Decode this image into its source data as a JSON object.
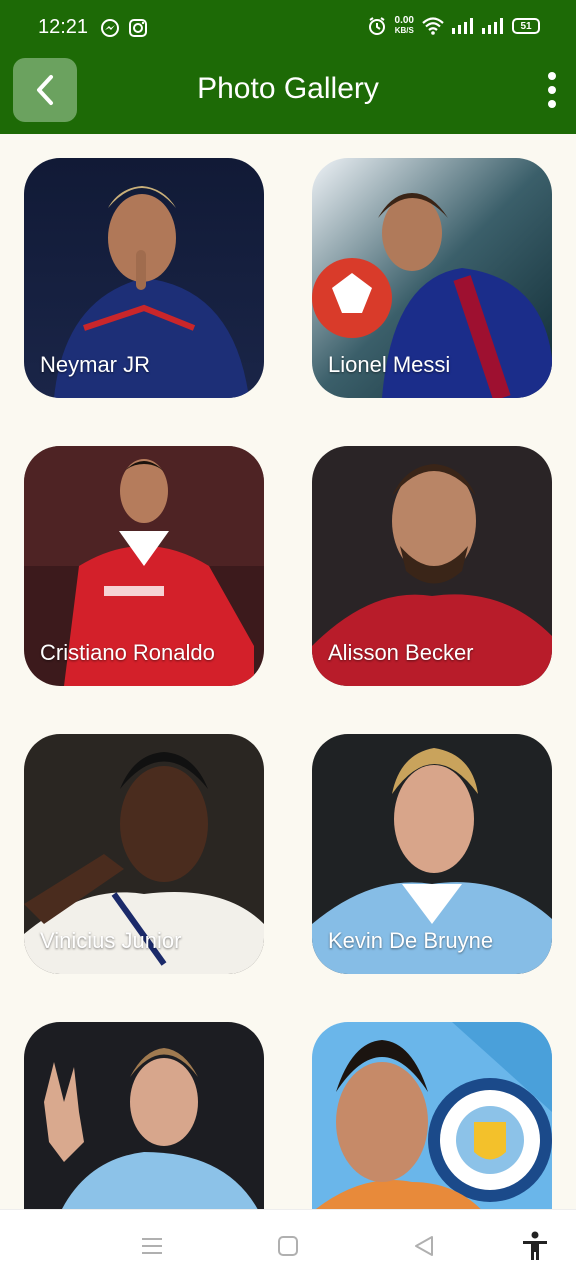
{
  "status": {
    "time": "12:21",
    "net_speed_value": "0.00",
    "net_speed_unit": "KB/S",
    "battery": "51"
  },
  "appbar": {
    "title": "Photo Gallery"
  },
  "gallery": {
    "items": [
      {
        "caption": "Neymar JR"
      },
      {
        "caption": "Lionel Messi"
      },
      {
        "caption": "Cristiano Ronaldo"
      },
      {
        "caption": "Alisson Becker"
      },
      {
        "caption": "Vinicius Junior"
      },
      {
        "caption": "Kevin De Bruyne"
      },
      {
        "caption": ""
      },
      {
        "caption": ""
      }
    ]
  },
  "icons": {
    "back": "chevron-left-icon",
    "menu": "more-vert-icon",
    "messenger": "messenger-icon",
    "instagram": "instagram-icon",
    "alarm": "alarm-icon",
    "wifi": "wifi-icon",
    "signal": "signal-icon",
    "nav_menu": "menu-icon",
    "nav_home": "home-icon",
    "nav_back": "back-triangle-icon",
    "accessibility": "accessibility-icon"
  },
  "colors": {
    "appbar": "#1d6a06",
    "back_button": "#6ba25f",
    "background": "#fbf9f1"
  }
}
